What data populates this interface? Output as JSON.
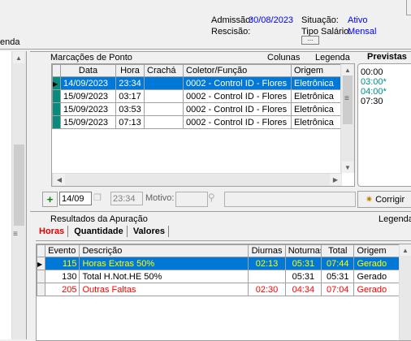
{
  "header": {
    "legenda_partial": "enda",
    "admissao_label": "Admissão:",
    "admissao_value": "30/08/2023",
    "rescisao_label": "Rescisão:",
    "situacao_label": "Situação:",
    "situacao_value": "Ativo",
    "tipo_salario_label": "Tipo Salário:",
    "tipo_salario_value": "Mensal",
    "more_button": "..."
  },
  "marcacoes": {
    "title": "Marcações de Ponto",
    "colunas": "Colunas",
    "legenda": "Legenda",
    "columns": [
      "Data",
      "Hora",
      "Crachá",
      "Coletor/Função",
      "Origem"
    ],
    "rows": [
      {
        "data": "14/09/2023",
        "hora": "23:34",
        "cracha": "",
        "coletor": "0002 - Control ID - Flores",
        "origem": "Eletrônica",
        "selected": true
      },
      {
        "data": "15/09/2023",
        "hora": "03:17",
        "cracha": "",
        "coletor": "0002 - Control ID - Flores",
        "origem": "Eletrônica",
        "selected": false
      },
      {
        "data": "15/09/2023",
        "hora": "03:53",
        "cracha": "",
        "coletor": "0002 - Control ID - Flores",
        "origem": "Eletrônica",
        "selected": false
      },
      {
        "data": "15/09/2023",
        "hora": "07:13",
        "cracha": "",
        "coletor": "0002 - Control ID - Flores",
        "origem": "Eletrônica",
        "selected": false
      }
    ]
  },
  "previstas": {
    "title": "Previstas",
    "items": [
      {
        "time": "00:00",
        "mark": "",
        "color": "#000000"
      },
      {
        "time": "03:00",
        "mark": "*",
        "color": "#008b8b"
      },
      {
        "time": "04:00",
        "mark": "*",
        "color": "#008b8b"
      },
      {
        "time": "07:30",
        "mark": "",
        "color": "#000000"
      }
    ],
    "corrigir": "Corrigir"
  },
  "toolbar": {
    "date_value": "14/09",
    "time_value": "23:34",
    "motivo_label": "Motivo:"
  },
  "resultados": {
    "title": "Resultados da Apuração",
    "legenda": "Legenda",
    "tabs": [
      "Horas",
      "Quantidade",
      "Valores"
    ],
    "active_tab": "Horas",
    "columns": [
      "Evento",
      "Descrição",
      "Diurnas",
      "Noturnas",
      "Total",
      "Origem"
    ],
    "rows": [
      {
        "evento": "115",
        "descricao": "Horas Extras 50%",
        "diurnas": "02:13",
        "noturnas": "05:31",
        "total": "07:44",
        "origem": "Gerado",
        "selected": true,
        "color": "#ffff00"
      },
      {
        "evento": "130",
        "descricao": "Total H.Not.HE 50%",
        "diurnas": "",
        "noturnas": "05:31",
        "total": "05:31",
        "origem": "Gerado",
        "selected": false,
        "color": "#000000"
      },
      {
        "evento": "205",
        "descricao": "Outras Faltas",
        "diurnas": "02:30",
        "noturnas": "04:34",
        "total": "07:04",
        "origem": "Gerado",
        "selected": false,
        "color": "#ff0000"
      }
    ]
  },
  "colors": {
    "accent": "#0078d7",
    "red": "#ff0000",
    "teal": "#0a8a7a"
  }
}
